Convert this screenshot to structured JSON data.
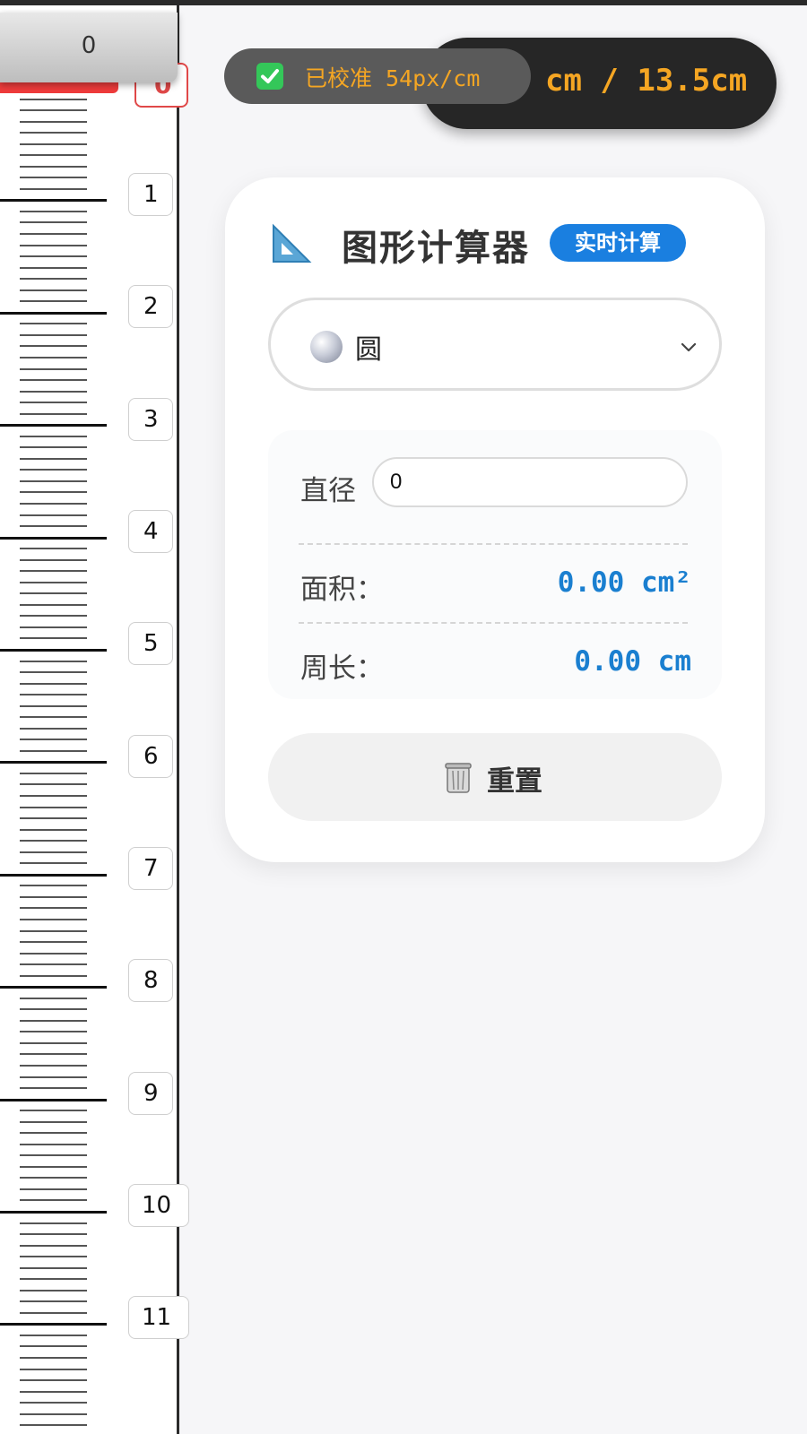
{
  "ruler": {
    "slider_value": "0",
    "zero_label": "0",
    "labels": [
      "1",
      "2",
      "3",
      "4",
      "5",
      "6",
      "7",
      "8",
      "9",
      "10",
      "11"
    ]
  },
  "status": {
    "length_text": "cm / 13.5cm",
    "calibration_text": "已校准 54px/cm",
    "calibration_color": "#f5a623"
  },
  "calculator": {
    "title": "图形计算器",
    "badge": "实时计算",
    "shape": {
      "icon": "sphere-icon",
      "selected": "圆"
    },
    "input": {
      "label": "直径",
      "value": "0"
    },
    "results": [
      {
        "label": "面积：",
        "value": "0.00 cm²"
      },
      {
        "label": "周长：",
        "value": "0.00 cm"
      }
    ],
    "reset_label": "重置",
    "accent_color": "#1a7fe0"
  }
}
